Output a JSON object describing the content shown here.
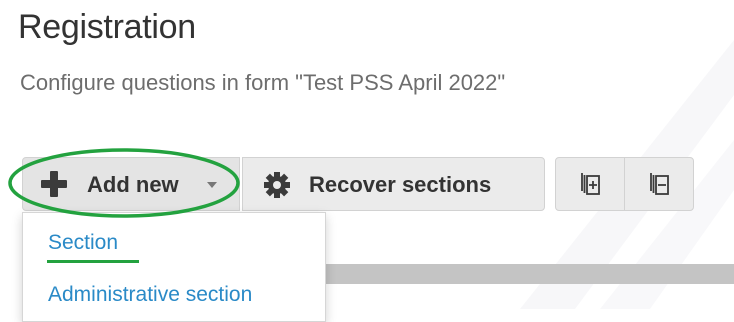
{
  "page": {
    "title": "Registration",
    "subtitle": "Configure questions in form \"Test PSS April 2022\""
  },
  "toolbar": {
    "add_new_label": "Add new",
    "recover_sections_label": "Recover sections",
    "expand_all_icon": "expand-all-icon",
    "collapse_all_icon": "collapse-all-icon"
  },
  "dropdown": {
    "items": [
      {
        "label": "Section"
      },
      {
        "label": "Administrative section"
      }
    ]
  },
  "colors": {
    "highlight_ellipse": "#23a23f",
    "link": "#2a8ac7",
    "button_bg": "#ebebeb",
    "title": "#333333",
    "subtitle": "#6d6d6d"
  }
}
